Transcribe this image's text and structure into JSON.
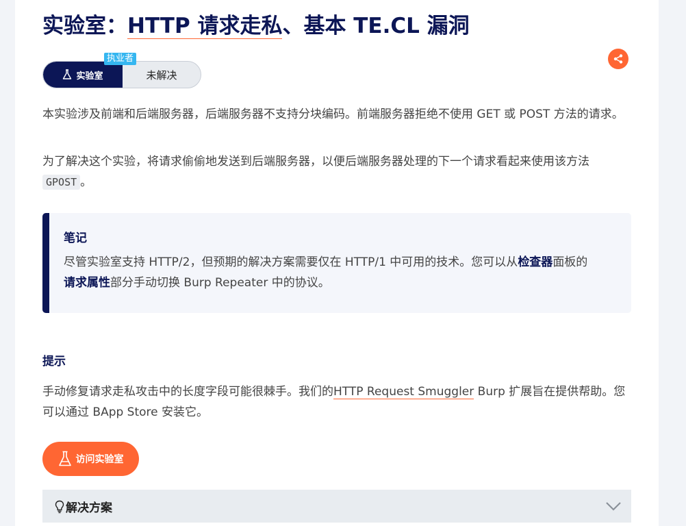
{
  "header": {
    "title_prefix": "实验室：",
    "title_link": "HTTP 请求走私",
    "title_suffix": "、基本 TE.CL 漏洞"
  },
  "status": {
    "badge": "执业者",
    "lab_label": "实验室",
    "state": "未解决"
  },
  "description": {
    "p1": "本实验涉及前端和后端服务器，后端服务器不支持分块编码。前端服务器拒绝不使用 GET 或 POST 方法的请求。",
    "p2_text": "为了解决这个实验，将请求偷偷地发送到后端服务器，以便后端服务器处理的下一个请求看起来使用该方法",
    "p2_code": "GPOST",
    "p2_end": "。"
  },
  "note": {
    "heading": "笔记",
    "text_1": "尽管实验室支持 HTTP/2，但预期的解决方案需要仅在 HTTP/1 中可用的技术。您可以从",
    "bold_1": "检查器",
    "text_2": "面板的",
    "bold_2": "请求属性",
    "text_3": "部分手动切换 Burp Repeater 中的协议。"
  },
  "hint": {
    "heading": "提示",
    "text_1": "手动修复请求走私攻击中的长度字段可能很棘手。我们的",
    "link": "HTTP Request Smuggler",
    "text_2": " Burp 扩展旨在提供帮助。您可以通过 BApp Store 安装它。"
  },
  "actions": {
    "access_lab": "访问实验室",
    "solution": "解决方案"
  },
  "icons": {
    "share": "share-icon",
    "flask": "flask-icon",
    "bulb": "lightbulb-icon",
    "chevron": "chevron-down-icon"
  },
  "colors": {
    "navy": "#0c1656",
    "accent": "#ff6633",
    "badge": "#35b6f0"
  }
}
